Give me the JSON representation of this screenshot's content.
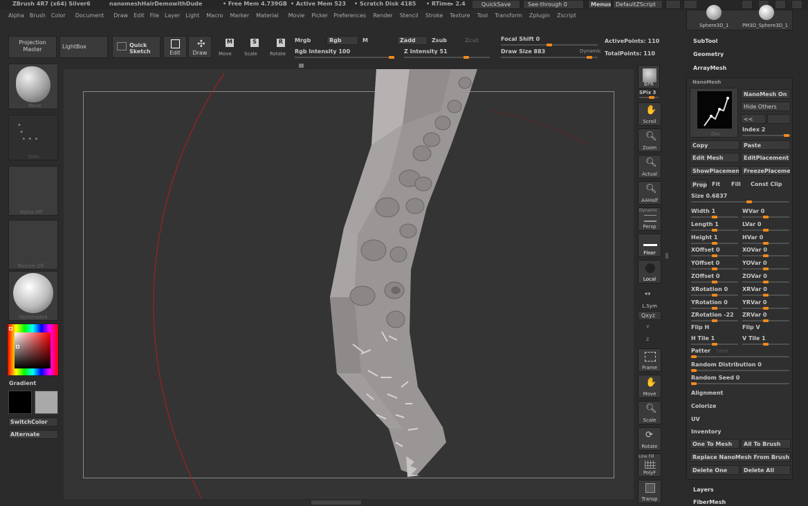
{
  "title_bar": {
    "app": "ZBrush 4R7 (x64) Silver6",
    "document": "nanomeshHairDemowithDude",
    "free_mem": "• Free Mem 4.739GB",
    "active_mem": "• Active Mem 523",
    "scratch": "• Scratch Disk 4185",
    "rtime": "• RTime▸ 2.4",
    "quicksave": "QuickSave",
    "see_through": "See-through  0",
    "menus": "Menus",
    "default_zscript": "DefaultZScript"
  },
  "menu_bar": [
    "Alpha",
    "Brush",
    "Color",
    "Document",
    "Draw",
    "Edit",
    "File",
    "Layer",
    "Light",
    "Macro",
    "Marker",
    "Material",
    "Movie",
    "Picker",
    "Preferences",
    "Render",
    "Stencil",
    "Stroke",
    "Texture",
    "Tool",
    "Transform",
    "Zplugin",
    "Zscript"
  ],
  "toolbar": {
    "projection_master": "Projection Master",
    "lightbox": "LightBox",
    "quick_sketch": "Quick Sketch",
    "edit": "Edit",
    "draw": "Draw",
    "move": "Move",
    "scale": "Scale",
    "rotate": "Rotate",
    "mrgb": "Mrgb",
    "rgb": "Rgb",
    "m": "M",
    "rgb_intensity": "Rgb Intensity 100",
    "zadd": "Zadd",
    "zsub": "Zsub",
    "zcut": "Zcut",
    "z_intensity": "Z Intensity 51",
    "focal_shift": "Focal Shift 0",
    "draw_size": "Draw Size 883",
    "dynamic": "Dynamic",
    "active_points": "ActivePoints: 110",
    "total_points": "TotalPoints: 110"
  },
  "left_shelf": {
    "brush_label": "Move",
    "stroke_label": "Dots",
    "alpha_label": "Alpha Off",
    "texture_label": "Texture Off",
    "material_label": "SkinShade4",
    "gradient": "Gradient",
    "switch_color": "SwitchColor",
    "alternate": "Alternate"
  },
  "right_shelf": [
    "BPR",
    "SPix 3",
    "Scroll",
    "Zoom",
    "Actual",
    "AAHalf",
    "Persp",
    "Floor",
    "Local",
    "L.Sym",
    "Qxyz",
    "Frame",
    "Move",
    "Scale",
    "Rotate",
    "PolyF",
    "Transp"
  ],
  "right_shelf_extra": {
    "dynamic": "Dynamic",
    "line_fill": "Line Fill"
  },
  "tool_panel": {
    "thumbs": [
      "Sphere3D_1",
      "PM3D_Sphere3D_1"
    ],
    "subtool": "SubTool",
    "geometry": "Geometry",
    "arraymesh": "ArrayMesh",
    "nanomesh": "NanoMesh",
    "nanomesh_on": "NanoMesh On",
    "hide_others": "Hide Others",
    "prev": "<<",
    "index": "Index 2",
    "doc": "Doc",
    "copy": "Copy",
    "paste": "Paste",
    "edit_mesh": "Edit Mesh",
    "edit_placement": "EditPlacement",
    "show_placement": "ShowPlacemen",
    "freeze_placement": "FreezePlaceme",
    "prop": "Prop",
    "fit": "Fit",
    "fill": "Fill",
    "const_clip": "Const Clip",
    "size": "Size 0.6837",
    "params": [
      [
        "Width 1",
        "WVar 0"
      ],
      [
        "Length 1",
        "LVar 0"
      ],
      [
        "Height 1",
        "HVar 0"
      ],
      [
        "XOffset 0",
        "XOVar 0"
      ],
      [
        "YOffset 0",
        "YOVar 0"
      ],
      [
        "ZOffset 0",
        "ZOVar 0"
      ],
      [
        "XRotation 0",
        "XRVar 0"
      ],
      [
        "YRotation 0",
        "YRVar 0"
      ],
      [
        "ZRotation -22",
        "ZRVar 0"
      ]
    ],
    "flip_h": "Flip H",
    "flip_v": "Flip V",
    "h_tile": "H Tile 1",
    "v_tile": "V Tile 1",
    "pattern": "Patter",
    "pattern_seed": "Seed",
    "random_distribution": "Random Distribution 0",
    "random_seed": "Random Seed 0",
    "alignment": "Alignment",
    "colorize": "Colorize",
    "uv": "UV",
    "inventory": "Inventory",
    "one_to_mesh": "One To Mesh",
    "all_to_brush": "All To Brush",
    "replace": "Replace NanoMesh From Brush",
    "delete_one": "Delete One",
    "delete_all": "Delete All",
    "layers": "Layers",
    "fibermesh": "FiberMesh"
  },
  "colors": {
    "accent": "#f08a1c",
    "canvas": "#343434",
    "bg": "#2b2b2b",
    "mesh": "#9a9595"
  }
}
